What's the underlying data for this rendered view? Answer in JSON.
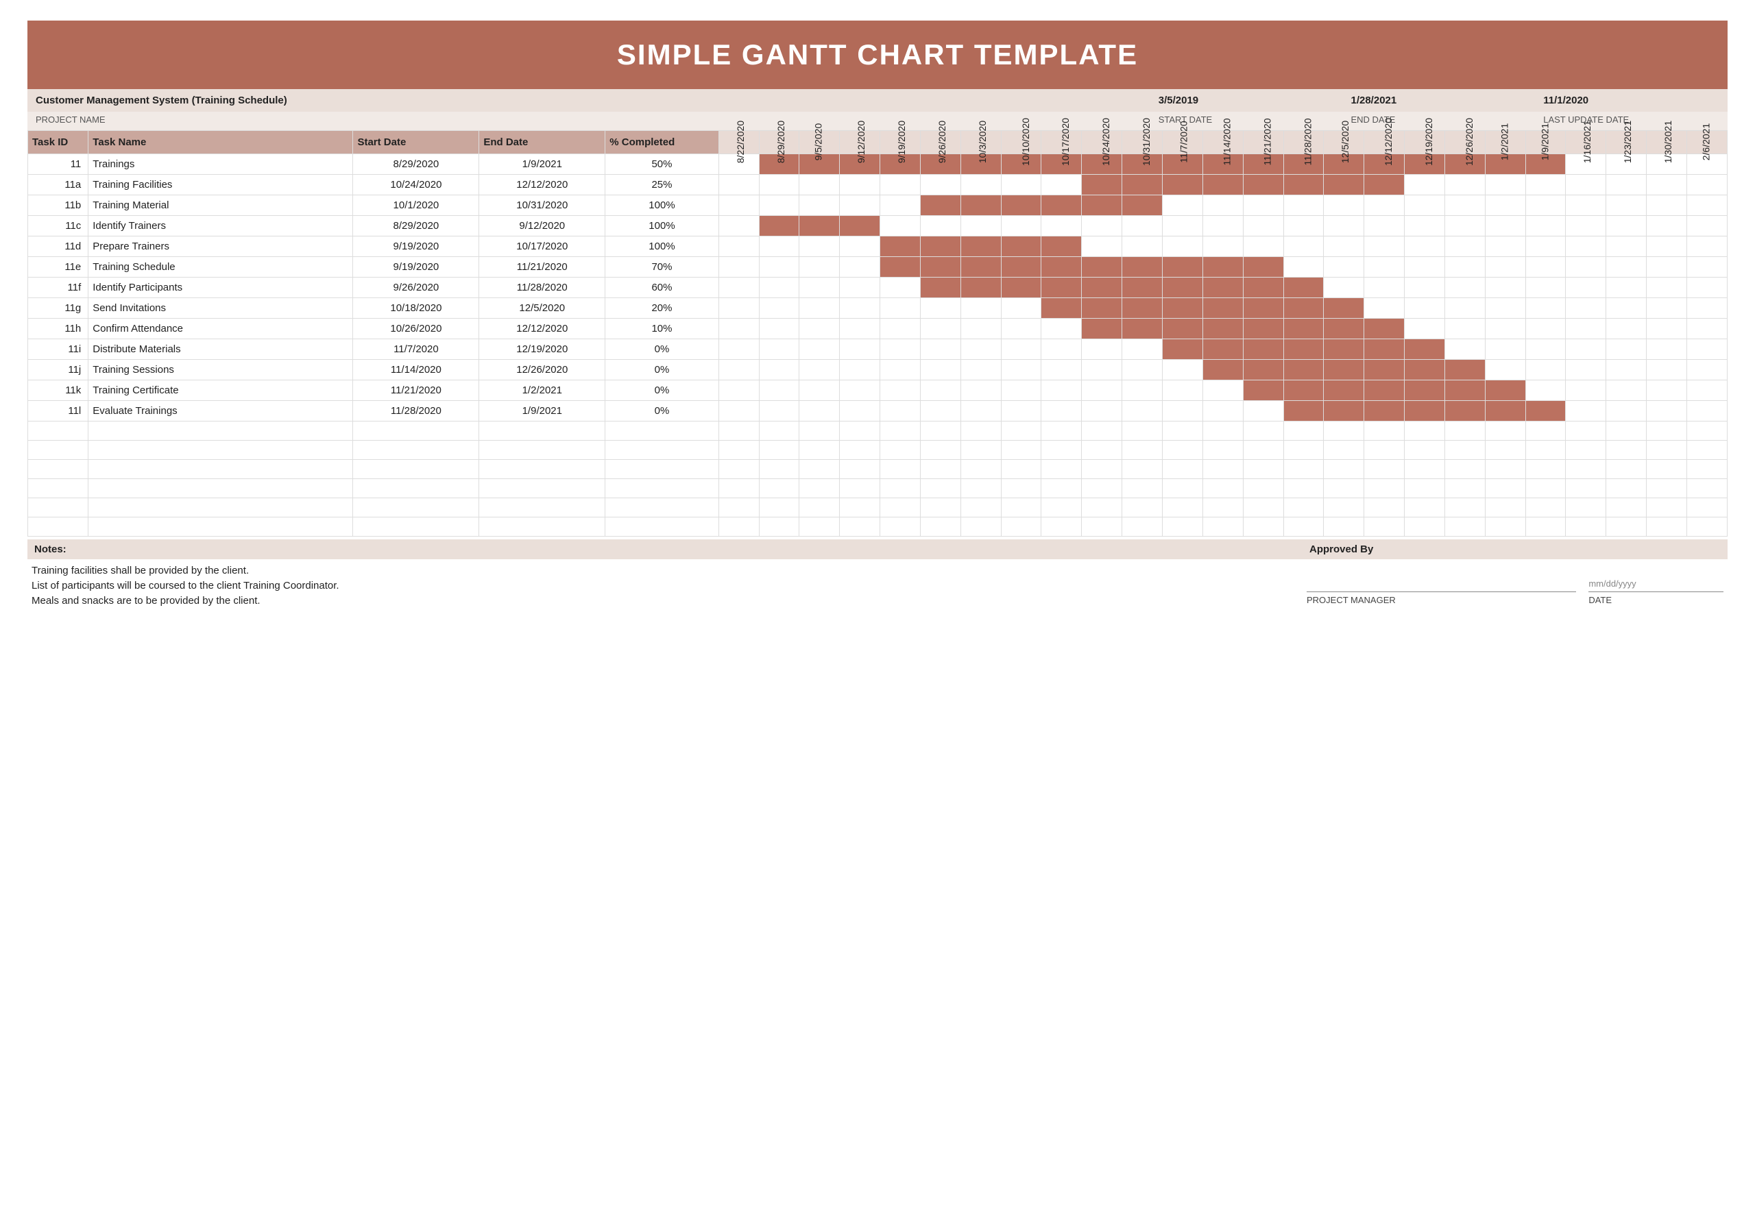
{
  "title": "SIMPLE GANTT CHART TEMPLATE",
  "meta": {
    "project_name": "Customer Management System (Training Schedule)",
    "project_name_label": "PROJECT NAME",
    "start_date": "3/5/2019",
    "start_date_label": "START DATE",
    "end_date": "1/28/2021",
    "end_date_label": "END DATE",
    "last_update": "11/1/2020",
    "last_update_label": "LAST UPDATE DATE"
  },
  "columns": {
    "task_id": "Task ID",
    "task_name": "Task Name",
    "start_date": "Start Date",
    "end_date": "End Date",
    "pct": "% Completed"
  },
  "weeks": [
    "8/22/2020",
    "8/29/2020",
    "9/5/2020",
    "9/12/2020",
    "9/19/2020",
    "9/26/2020",
    "10/3/2020",
    "10/10/2020",
    "10/17/2020",
    "10/24/2020",
    "10/31/2020",
    "11/7/2020",
    "11/14/2020",
    "11/21/2020",
    "11/28/2020",
    "12/5/2020",
    "12/12/2020",
    "12/19/2020",
    "12/26/2020",
    "1/2/2021",
    "1/9/2021",
    "1/16/2021",
    "1/23/2021",
    "1/30/2021",
    "2/6/2021"
  ],
  "tasks": [
    {
      "id": "11",
      "name": "Trainings",
      "start": "8/29/2020",
      "end": "1/9/2021",
      "pct": "50%"
    },
    {
      "id": "11a",
      "name": "Training Facilities",
      "start": "10/24/2020",
      "end": "12/12/2020",
      "pct": "25%"
    },
    {
      "id": "11b",
      "name": "Training Material",
      "start": "10/1/2020",
      "end": "10/31/2020",
      "pct": "100%"
    },
    {
      "id": "11c",
      "name": "Identify Trainers",
      "start": "8/29/2020",
      "end": "9/12/2020",
      "pct": "100%"
    },
    {
      "id": "11d",
      "name": "Prepare Trainers",
      "start": "9/19/2020",
      "end": "10/17/2020",
      "pct": "100%"
    },
    {
      "id": "11e",
      "name": "Training Schedule",
      "start": "9/19/2020",
      "end": "11/21/2020",
      "pct": "70%"
    },
    {
      "id": "11f",
      "name": "Identify Participants",
      "start": "9/26/2020",
      "end": "11/28/2020",
      "pct": "60%"
    },
    {
      "id": "11g",
      "name": "Send Invitations",
      "start": "10/18/2020",
      "end": "12/5/2020",
      "pct": "20%"
    },
    {
      "id": "11h",
      "name": "Confirm Attendance",
      "start": "10/26/2020",
      "end": "12/12/2020",
      "pct": "10%"
    },
    {
      "id": "11i",
      "name": "Distribute Materials",
      "start": "11/7/2020",
      "end": "12/19/2020",
      "pct": "0%"
    },
    {
      "id": "11j",
      "name": "Training Sessions",
      "start": "11/14/2020",
      "end": "12/26/2020",
      "pct": "0%"
    },
    {
      "id": "11k",
      "name": "Training Certificate",
      "start": "11/21/2020",
      "end": "1/2/2021",
      "pct": "0%"
    },
    {
      "id": "11l",
      "name": "Evaluate Trainings",
      "start": "11/28/2020",
      "end": "1/9/2021",
      "pct": "0%"
    }
  ],
  "blank_rows": 6,
  "notes_label": "Notes:",
  "notes": [
    "Training facilities shall be provided by the client.",
    "List of participants will be coursed to the client Training Coordinator.",
    "Meals and snacks are to be provided by the client."
  ],
  "approved_by_label": "Approved By",
  "sign": {
    "pm_label": "PROJECT MANAGER",
    "date_label": "DATE",
    "date_placeholder": "mm/dd/yyyy"
  },
  "chart_data": {
    "type": "bar",
    "orientation": "horizontal_timeline",
    "title": "Simple Gantt Chart — Customer Management System (Training Schedule)",
    "x_ticks": [
      "8/22/2020",
      "8/29/2020",
      "9/5/2020",
      "9/12/2020",
      "9/19/2020",
      "9/26/2020",
      "10/3/2020",
      "10/10/2020",
      "10/17/2020",
      "10/24/2020",
      "10/31/2020",
      "11/7/2020",
      "11/14/2020",
      "11/21/2020",
      "11/28/2020",
      "12/5/2020",
      "12/12/2020",
      "12/19/2020",
      "12/26/2020",
      "1/2/2021",
      "1/9/2021",
      "1/16/2021",
      "1/23/2021",
      "1/30/2021",
      "2/6/2021"
    ],
    "series": [
      {
        "name": "Trainings",
        "start": "8/29/2020",
        "end": "1/9/2021",
        "pct_complete": 50,
        "start_index": 1,
        "end_index": 20
      },
      {
        "name": "Training Facilities",
        "start": "10/24/2020",
        "end": "12/12/2020",
        "pct_complete": 25,
        "start_index": 9,
        "end_index": 16
      },
      {
        "name": "Training Material",
        "start": "10/1/2020",
        "end": "10/31/2020",
        "pct_complete": 100,
        "start_index": 5,
        "end_index": 10
      },
      {
        "name": "Identify Trainers",
        "start": "8/29/2020",
        "end": "9/12/2020",
        "pct_complete": 100,
        "start_index": 1,
        "end_index": 3
      },
      {
        "name": "Prepare Trainers",
        "start": "9/19/2020",
        "end": "10/17/2020",
        "pct_complete": 100,
        "start_index": 4,
        "end_index": 8
      },
      {
        "name": "Training Schedule",
        "start": "9/19/2020",
        "end": "11/21/2020",
        "pct_complete": 70,
        "start_index": 4,
        "end_index": 13
      },
      {
        "name": "Identify Participants",
        "start": "9/26/2020",
        "end": "11/28/2020",
        "pct_complete": 60,
        "start_index": 5,
        "end_index": 14
      },
      {
        "name": "Send Invitations",
        "start": "10/18/2020",
        "end": "12/5/2020",
        "pct_complete": 20,
        "start_index": 8,
        "end_index": 15
      },
      {
        "name": "Confirm Attendance",
        "start": "10/26/2020",
        "end": "12/12/2020",
        "pct_complete": 10,
        "start_index": 9,
        "end_index": 16
      },
      {
        "name": "Distribute Materials",
        "start": "11/7/2020",
        "end": "12/19/2020",
        "pct_complete": 0,
        "start_index": 11,
        "end_index": 17
      },
      {
        "name": "Training Sessions",
        "start": "11/14/2020",
        "end": "12/26/2020",
        "pct_complete": 0,
        "start_index": 12,
        "end_index": 18
      },
      {
        "name": "Training Certificate",
        "start": "11/21/2020",
        "end": "1/2/2021",
        "pct_complete": 0,
        "start_index": 13,
        "end_index": 19
      },
      {
        "name": "Evaluate Trainings",
        "start": "11/28/2020",
        "end": "1/9/2021",
        "pct_complete": 0,
        "start_index": 14,
        "end_index": 20
      }
    ],
    "bar_color": "#bb7160"
  }
}
